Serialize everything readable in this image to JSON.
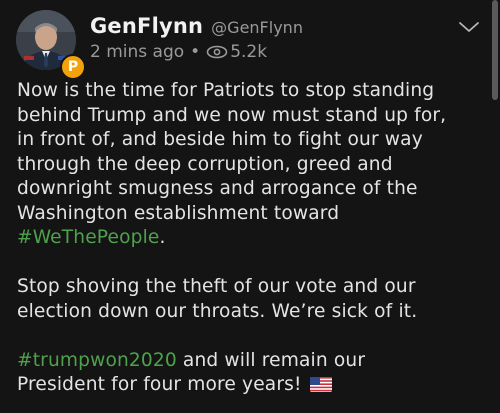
{
  "post": {
    "author": {
      "display_name": "GenFlynn",
      "handle": "@GenFlynn",
      "badge": "P"
    },
    "timestamp": "2 mins ago",
    "separator": "•",
    "views": "5.2k",
    "icons": {
      "avatar": "profile-photo",
      "badge": "parler-badge-icon",
      "views": "eye-icon",
      "menu": "chevron-down-icon",
      "flag": "us-flag-icon"
    },
    "colors": {
      "background": "#141414",
      "text": "#e4e4e4",
      "muted": "#9a9a9a",
      "hashtag": "#4ea24c",
      "badge": "#f2a20b"
    },
    "paragraph1": {
      "lines": [
        "Now is the time for Patriots to stop standing",
        "behind Trump and we now must stand up for,",
        "in front of, and beside him to fight our way",
        "through the deep corruption, greed and",
        "downright smugness and arrogance of the",
        "Washington establishment toward"
      ],
      "hashtag": "#WeThePeople",
      "hashtag_suffix": "."
    },
    "paragraph2": {
      "lines": [
        "Stop shoving the theft of our vote and our",
        "election down our throats. We’re sick of it."
      ]
    },
    "paragraph3": {
      "hashtag": "#trumpwon2020",
      "line1_rest": " and will remain our",
      "line2": "President for four more years! "
    }
  }
}
